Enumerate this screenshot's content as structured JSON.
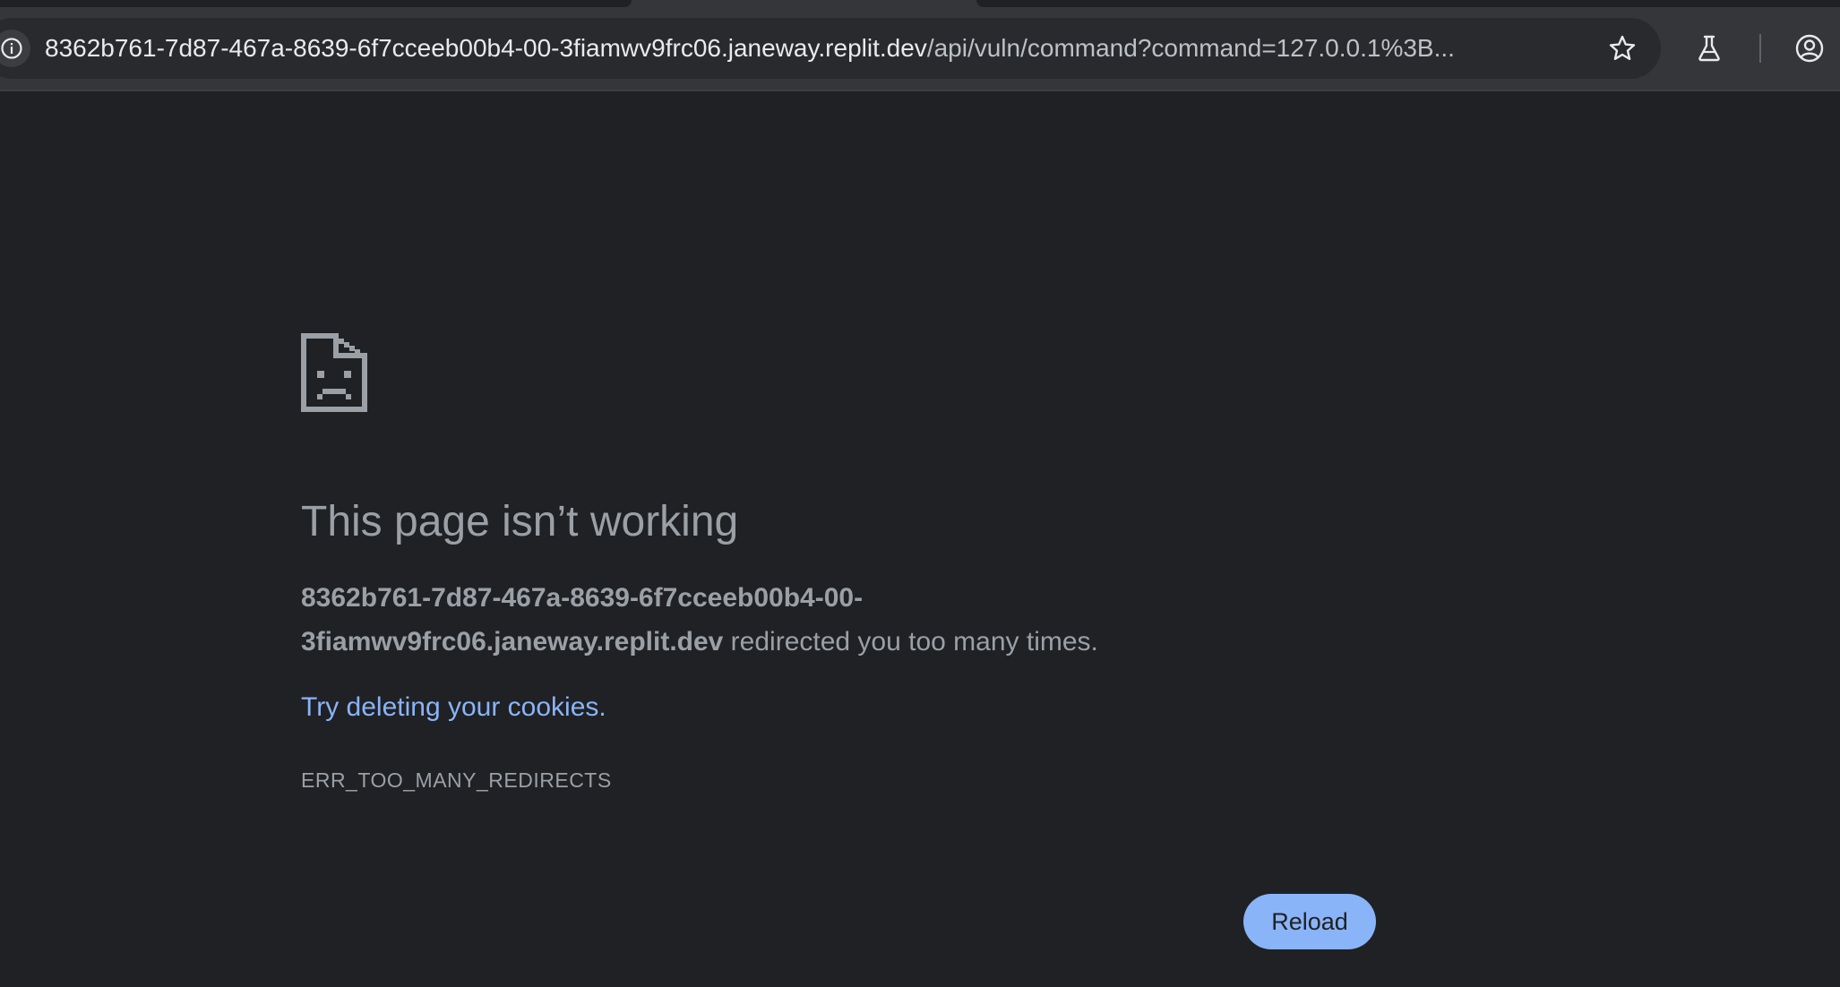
{
  "browser": {
    "url": {
      "host": "8362b761-7d87-467a-8639-6f7cceeb00b4-00-3fiamwv9frc06.janeway.replit.dev",
      "path": "/api/vuln/command?command=127.0.0.1%3B..."
    },
    "icons": {
      "site_info": "info-icon",
      "bookmark": "star-icon",
      "labs": "flask-icon",
      "profile": "profile-icon"
    }
  },
  "error_page": {
    "icon": "sad-page-icon",
    "title": "This page isn’t working",
    "host_bold_line1": "8362b761-7d87-467a-8639-6f7cceeb00b4-00-",
    "host_bold_line2": "3fiamwv9frc06.janeway.replit.dev",
    "detail_suffix": " redirected you too many times.",
    "suggestion": "Try deleting your cookies.",
    "error_code": "ERR_TOO_MANY_REDIRECTS",
    "reload_label": "Reload"
  },
  "colors": {
    "background": "#202124",
    "toolbar": "#35363a",
    "omnibox": "#282a2d",
    "text_muted": "#9aa0a6",
    "link": "#8ab4f8",
    "button_bg": "#8ab4f8"
  }
}
